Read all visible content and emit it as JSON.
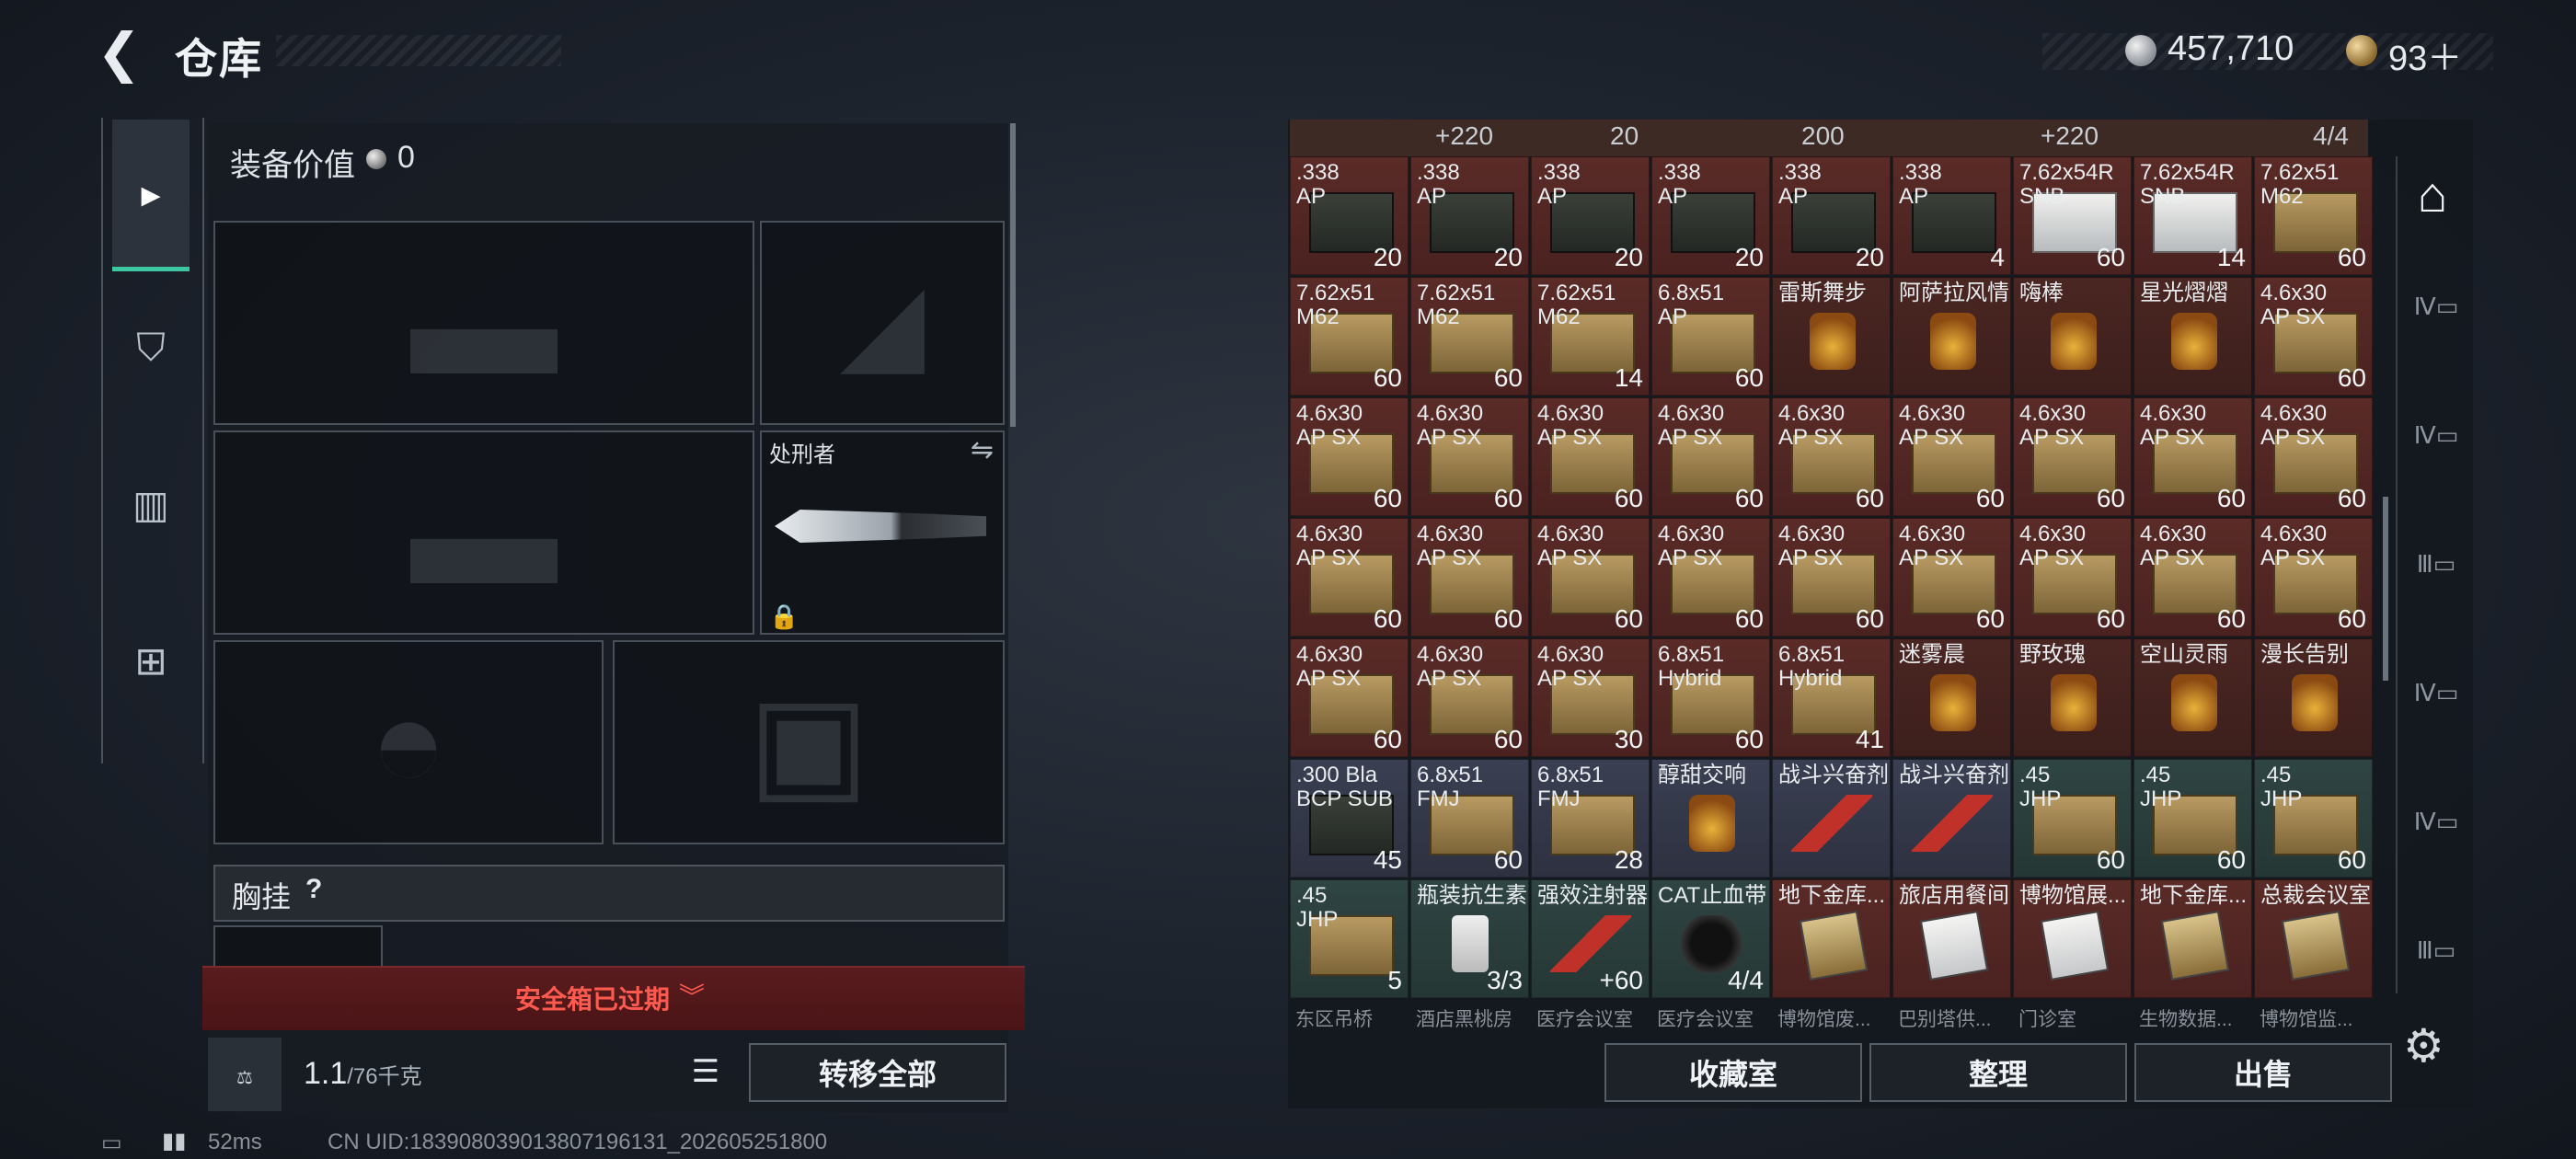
{
  "header": {
    "title": "仓库",
    "silver": "457,710",
    "gold": "93＋"
  },
  "equipment": {
    "value_label": "装备价值",
    "value": "0",
    "knife_name": "处刑者",
    "vest_label": "胸挂",
    "vest_help": "?",
    "safe_box_status": "安全箱已过期",
    "weight_value": "1.1",
    "weight_max": "/76千克",
    "transfer_all": "转移全部"
  },
  "inventory": {
    "top_strip": [
      "+220",
      "20",
      "200",
      "+220",
      "4/4"
    ],
    "cells": [
      {
        "name": ".338\nAP",
        "count": "20",
        "kind": "can",
        "bg": "bg-ammo"
      },
      {
        "name": ".338\nAP",
        "count": "20",
        "kind": "can",
        "bg": "bg-ammo"
      },
      {
        "name": ".338\nAP",
        "count": "20",
        "kind": "can",
        "bg": "bg-ammo"
      },
      {
        "name": ".338\nAP",
        "count": "20",
        "kind": "can",
        "bg": "bg-ammo"
      },
      {
        "name": ".338\nAP",
        "count": "20",
        "kind": "can",
        "bg": "bg-ammo"
      },
      {
        "name": ".338\nAP",
        "count": "4",
        "kind": "can",
        "bg": "bg-ammo"
      },
      {
        "name": "7.62x54R\nSNB",
        "count": "60",
        "kind": "canw",
        "bg": "bg-ammo"
      },
      {
        "name": "7.62x54R\nSNB",
        "count": "14",
        "kind": "canw",
        "bg": "bg-ammo"
      },
      {
        "name": "7.62x51\nM62",
        "count": "60",
        "kind": "box",
        "bg": "bg-ammo"
      },
      {
        "name": "7.62x51\nM62",
        "count": "60",
        "kind": "box",
        "bg": "bg-ammo"
      },
      {
        "name": "7.62x51\nM62",
        "count": "60",
        "kind": "box",
        "bg": "bg-ammo"
      },
      {
        "name": "7.62x51\nM62",
        "count": "14",
        "kind": "box",
        "bg": "bg-ammo"
      },
      {
        "name": "6.8x51\nAP",
        "count": "60",
        "kind": "box",
        "bg": "bg-ammo"
      },
      {
        "name": "雷斯舞步",
        "count": "",
        "kind": "drink",
        "bg": "bg-drink"
      },
      {
        "name": "阿萨拉风情",
        "count": "",
        "kind": "drink",
        "bg": "bg-drink"
      },
      {
        "name": "嗨棒",
        "count": "",
        "kind": "drink",
        "bg": "bg-drink"
      },
      {
        "name": "星光熠熠",
        "count": "",
        "kind": "drink",
        "bg": "bg-drink"
      },
      {
        "name": "4.6x30\nAP SX",
        "count": "60",
        "kind": "box",
        "bg": "bg-ammo"
      },
      {
        "name": "4.6x30\nAP SX",
        "count": "60",
        "kind": "box",
        "bg": "bg-ammo"
      },
      {
        "name": "4.6x30\nAP SX",
        "count": "60",
        "kind": "box",
        "bg": "bg-ammo"
      },
      {
        "name": "4.6x30\nAP SX",
        "count": "60",
        "kind": "box",
        "bg": "bg-ammo"
      },
      {
        "name": "4.6x30\nAP SX",
        "count": "60",
        "kind": "box",
        "bg": "bg-ammo"
      },
      {
        "name": "4.6x30\nAP SX",
        "count": "60",
        "kind": "box",
        "bg": "bg-ammo"
      },
      {
        "name": "4.6x30\nAP SX",
        "count": "60",
        "kind": "box",
        "bg": "bg-ammo"
      },
      {
        "name": "4.6x30\nAP SX",
        "count": "60",
        "kind": "box",
        "bg": "bg-ammo"
      },
      {
        "name": "4.6x30\nAP SX",
        "count": "60",
        "kind": "box",
        "bg": "bg-ammo"
      },
      {
        "name": "4.6x30\nAP SX",
        "count": "60",
        "kind": "box",
        "bg": "bg-ammo"
      },
      {
        "name": "4.6x30\nAP SX",
        "count": "60",
        "kind": "box",
        "bg": "bg-ammo"
      },
      {
        "name": "4.6x30\nAP SX",
        "count": "60",
        "kind": "box",
        "bg": "bg-ammo"
      },
      {
        "name": "4.6x30\nAP SX",
        "count": "60",
        "kind": "box",
        "bg": "bg-ammo"
      },
      {
        "name": "4.6x30\nAP SX",
        "count": "60",
        "kind": "box",
        "bg": "bg-ammo"
      },
      {
        "name": "4.6x30\nAP SX",
        "count": "60",
        "kind": "box",
        "bg": "bg-ammo"
      },
      {
        "name": "4.6x30\nAP SX",
        "count": "60",
        "kind": "box",
        "bg": "bg-ammo"
      },
      {
        "name": "4.6x30\nAP SX",
        "count": "60",
        "kind": "box",
        "bg": "bg-ammo"
      },
      {
        "name": "4.6x30\nAP SX",
        "count": "60",
        "kind": "box",
        "bg": "bg-ammo"
      },
      {
        "name": "4.6x30\nAP SX",
        "count": "60",
        "kind": "box",
        "bg": "bg-ammo"
      },
      {
        "name": "4.6x30\nAP SX",
        "count": "60",
        "kind": "box",
        "bg": "bg-ammo"
      },
      {
        "name": "4.6x30\nAP SX",
        "count": "60",
        "kind": "box",
        "bg": "bg-ammo"
      },
      {
        "name": "4.6x30\nAP SX",
        "count": "30",
        "kind": "box",
        "bg": "bg-ammo"
      },
      {
        "name": "6.8x51\nHybrid",
        "count": "60",
        "kind": "box",
        "bg": "bg-ammo"
      },
      {
        "name": "6.8x51\nHybrid",
        "count": "41",
        "kind": "box",
        "bg": "bg-ammo"
      },
      {
        "name": "迷雾晨",
        "count": "",
        "kind": "drink",
        "bg": "bg-drink"
      },
      {
        "name": "野玫瑰",
        "count": "",
        "kind": "drink",
        "bg": "bg-drink"
      },
      {
        "name": "空山灵雨",
        "count": "",
        "kind": "drink",
        "bg": "bg-drink"
      },
      {
        "name": "漫长告别",
        "count": "",
        "kind": "drink",
        "bg": "bg-drink"
      },
      {
        "name": ".300 Bla\nBCP SUB",
        "count": "45",
        "kind": "can",
        "bg": "bg-dark"
      },
      {
        "name": "6.8x51\nFMJ",
        "count": "60",
        "kind": "box",
        "bg": "bg-dark"
      },
      {
        "name": "6.8x51\nFMJ",
        "count": "28",
        "kind": "box",
        "bg": "bg-dark"
      },
      {
        "name": "醇甜交响",
        "count": "",
        "kind": "drink",
        "bg": "bg-dark"
      },
      {
        "name": "战斗兴奋剂",
        "count": "",
        "kind": "inj",
        "bg": "bg-dark"
      },
      {
        "name": "战斗兴奋剂",
        "count": "",
        "kind": "inj",
        "bg": "bg-dark"
      },
      {
        "name": ".45\nJHP",
        "count": "60",
        "kind": "box",
        "bg": "bg-teal"
      },
      {
        "name": ".45\nJHP",
        "count": "60",
        "kind": "box",
        "bg": "bg-teal"
      },
      {
        "name": ".45\nJHP",
        "count": "60",
        "kind": "box",
        "bg": "bg-teal"
      },
      {
        "name": ".45\nJHP",
        "count": "5",
        "kind": "box",
        "bg": "bg-teal"
      },
      {
        "name": "瓶装抗生素",
        "count": "3/3",
        "kind": "pills",
        "bg": "bg-teal"
      },
      {
        "name": "强效注射器",
        "count": "+60",
        "kind": "inj",
        "bg": "bg-teal"
      },
      {
        "name": "CAT止血带",
        "count": "4/4",
        "kind": "tourn",
        "bg": "bg-teal"
      },
      {
        "name": "地下金库...",
        "count": "",
        "kind": "keycard",
        "bg": "bg-key"
      },
      {
        "name": "旅店用餐间",
        "count": "",
        "kind": "keycardw",
        "bg": "bg-key"
      },
      {
        "name": "博物馆展...",
        "count": "",
        "kind": "keycardw",
        "bg": "bg-key"
      },
      {
        "name": "地下金库...",
        "count": "",
        "kind": "keycard",
        "bg": "bg-key"
      },
      {
        "name": "总裁会议室",
        "count": "",
        "kind": "keycard",
        "bg": "bg-key"
      }
    ],
    "next_row": [
      "东区吊桥",
      "酒店黑桃房",
      "医疗会议室",
      "医疗会议室",
      "博物馆废...",
      "巴别塔供...",
      "门诊室",
      "生物数据...",
      "博物馆监..."
    ],
    "buttons": {
      "collection": "收藏室",
      "sort": "整理",
      "sell": "出售"
    }
  },
  "status": {
    "ping": "52ms",
    "uid": "CN UID:183908039013807196131_202605251800"
  },
  "colors": {
    "accent": "#3bc7a0",
    "warning": "#ff5a50"
  }
}
